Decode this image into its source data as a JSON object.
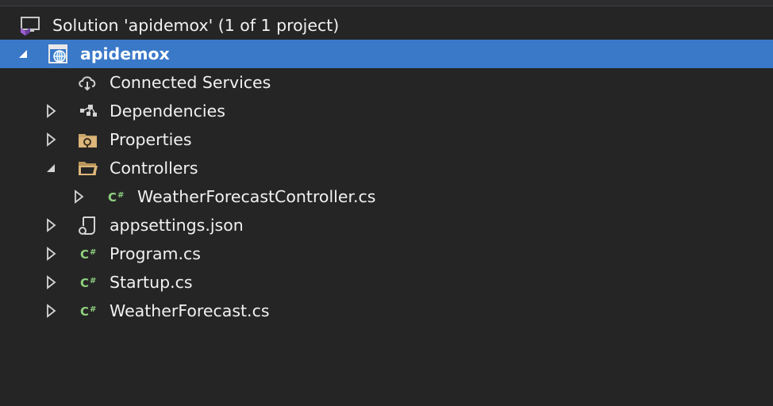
{
  "solution_explorer": {
    "solution": {
      "label": "Solution 'apidemox' (1 of 1 project)",
      "icon": "solution-icon"
    },
    "project": {
      "label": "apidemox",
      "icon": "web-project-icon",
      "expanded": true,
      "selected": true
    },
    "items": [
      {
        "label": "Connected Services",
        "icon": "connected-services-icon"
      },
      {
        "label": "Dependencies",
        "icon": "dependencies-icon",
        "expanded": false
      },
      {
        "label": "Properties",
        "icon": "properties-folder-icon",
        "expanded": false
      },
      {
        "label": "Controllers",
        "icon": "folder-icon",
        "expanded": true
      },
      {
        "label": "WeatherForecastController.cs",
        "icon": "csharp-file-icon",
        "expanded": false
      },
      {
        "label": "appsettings.json",
        "icon": "json-file-icon",
        "expanded": false
      },
      {
        "label": "Program.cs",
        "icon": "csharp-file-icon",
        "expanded": false
      },
      {
        "label": "Startup.cs",
        "icon": "csharp-file-icon",
        "expanded": false
      },
      {
        "label": "WeatherForecast.cs",
        "icon": "csharp-file-icon",
        "expanded": false
      }
    ],
    "colors": {
      "background": "#252526",
      "selection": "#3a78c8",
      "text": "#f1f1f1",
      "csharp_green": "#8fd17e",
      "folder_tan": "#dcb67a"
    }
  }
}
